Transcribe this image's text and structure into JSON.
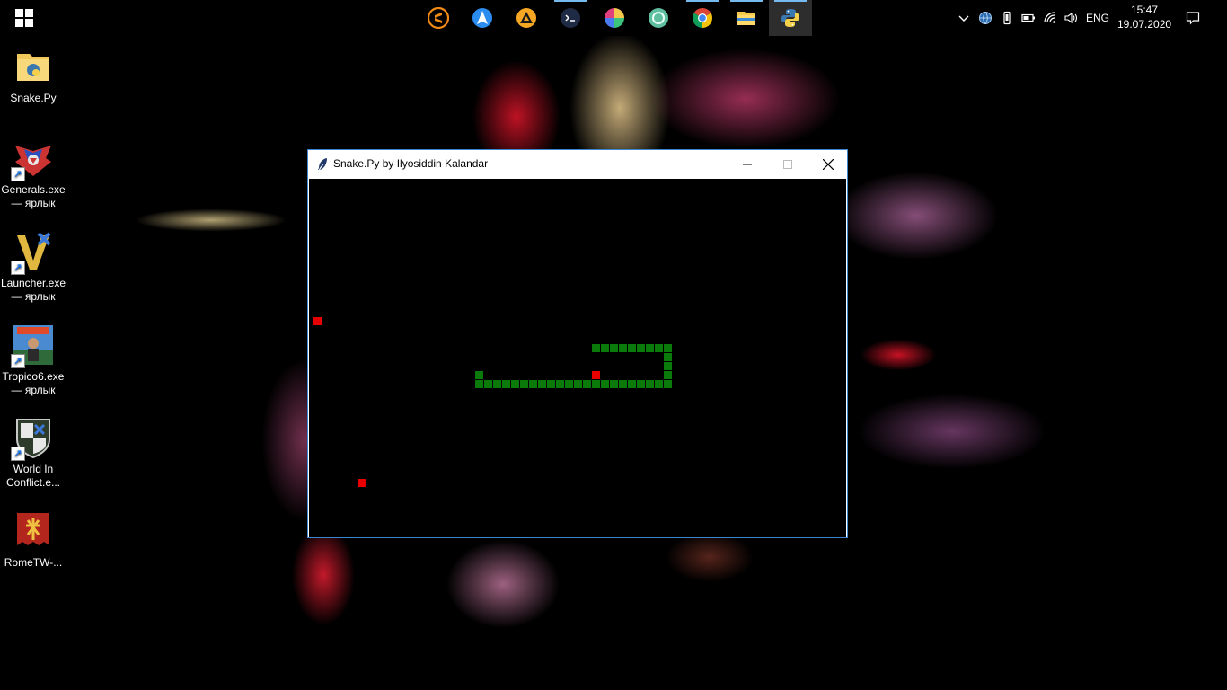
{
  "taskbar": {
    "apps": [
      {
        "name": "sublime-text",
        "color": "#f28b16"
      },
      {
        "name": "navigation-app",
        "color": "#2b8cf0"
      },
      {
        "name": "aimp",
        "color": "#f5a623"
      },
      {
        "name": "terminal",
        "color": "#1f2a44"
      },
      {
        "name": "color-picker",
        "color": "#e0407b"
      },
      {
        "name": "media-app",
        "color": "#5fbfa0"
      },
      {
        "name": "chrome",
        "color": "#db4437"
      },
      {
        "name": "file-explorer",
        "color": "#f5c84c"
      },
      {
        "name": "python",
        "color": "#3b78b0"
      }
    ],
    "tray": {
      "language": "ENG",
      "time": "15:47",
      "date": "19.07.2020"
    }
  },
  "desktop_icons": [
    {
      "label_lines": [
        "Snake.Py"
      ],
      "icon": "python-file-folder-icon"
    },
    {
      "label_lines": [
        "Generals.exe",
        "— ярлык"
      ],
      "icon": "generals-icon"
    },
    {
      "label_lines": [
        "Launcher.exe",
        "— ярлык"
      ],
      "icon": "launcher-icon"
    },
    {
      "label_lines": [
        "Tropico6.exe",
        "— ярлык"
      ],
      "icon": "tropico-icon"
    },
    {
      "label_lines": [
        "World In",
        "Conflict.e..."
      ],
      "icon": "world-in-conflict-icon"
    },
    {
      "label_lines": [
        "RomeTW-..."
      ],
      "icon": "rome-tw-icon"
    }
  ],
  "window": {
    "title": "Snake.Py by Ilyosiddin Kalandar",
    "controls": [
      "minimize",
      "maximize",
      "close"
    ]
  },
  "game": {
    "background": "#000000",
    "snake_color": "#0a7a0a",
    "food_color": "#e60000",
    "grid_cols": 60,
    "grid_rows": 40,
    "snake": [
      [
        31,
        18
      ],
      [
        32,
        18
      ],
      [
        33,
        18
      ],
      [
        34,
        18
      ],
      [
        35,
        18
      ],
      [
        36,
        18
      ],
      [
        37,
        18
      ],
      [
        38,
        18
      ],
      [
        39,
        18
      ],
      [
        39,
        19
      ],
      [
        39,
        20
      ],
      [
        39,
        21
      ],
      [
        39,
        22
      ],
      [
        38,
        22
      ],
      [
        37,
        22
      ],
      [
        36,
        22
      ],
      [
        35,
        22
      ],
      [
        34,
        22
      ],
      [
        33,
        22
      ],
      [
        32,
        22
      ],
      [
        31,
        22
      ],
      [
        30,
        22
      ],
      [
        29,
        22
      ],
      [
        28,
        22
      ],
      [
        27,
        22
      ],
      [
        26,
        22
      ],
      [
        25,
        22
      ],
      [
        24,
        22
      ],
      [
        23,
        22
      ],
      [
        22,
        22
      ],
      [
        21,
        22
      ],
      [
        20,
        22
      ],
      [
        19,
        22
      ],
      [
        18,
        22
      ],
      [
        18,
        21
      ]
    ],
    "food": [
      [
        0,
        15
      ],
      [
        31,
        21
      ],
      [
        5,
        33
      ]
    ]
  }
}
